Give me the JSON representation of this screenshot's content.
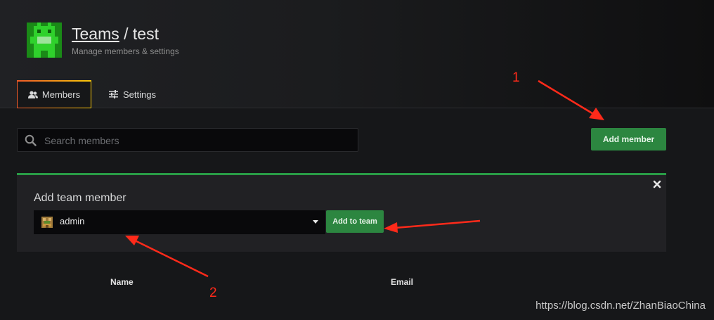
{
  "header": {
    "breadcrumb_root": "Teams",
    "separator": "/",
    "team_name": "test",
    "subtitle": "Manage members & settings",
    "avatar_icon": "pixel-team-avatar-icon",
    "avatar_color": "#2fd12c"
  },
  "tabs": [
    {
      "label": "Members",
      "icon": "users-icon",
      "active": true
    },
    {
      "label": "Settings",
      "icon": "sliders-icon",
      "active": false
    }
  ],
  "search": {
    "placeholder": "Search members",
    "value": ""
  },
  "actions": {
    "add_member_label": "Add member"
  },
  "add_panel": {
    "title": "Add team member",
    "selected_user": "admin",
    "add_to_team_label": "Add to team",
    "accent_color": "#299c46"
  },
  "table": {
    "columns": [
      "Name",
      "Email"
    ]
  },
  "annotations": {
    "label_1": "1",
    "label_2": "2",
    "color": "#ff2a1a"
  },
  "watermark": "https://blog.csdn.net/ZhanBiaoChina",
  "colors": {
    "button_green": "#2c8640",
    "background": "#161719"
  }
}
